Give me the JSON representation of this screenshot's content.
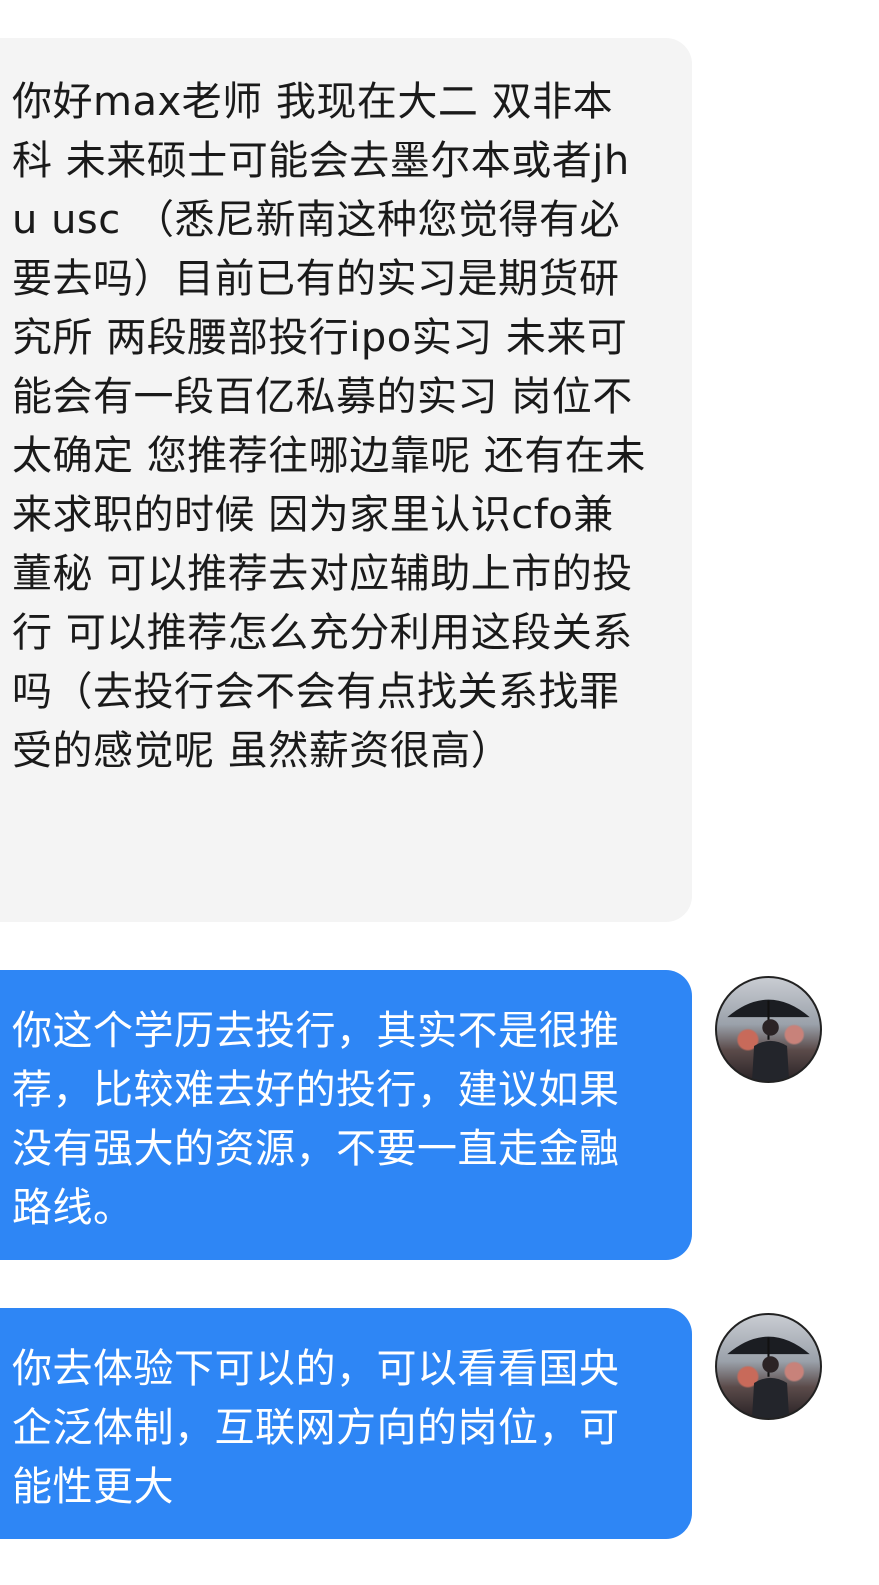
{
  "messages": [
    {
      "sender": "user",
      "text": "你好max老师 我现在大二 双非本科 未来硕士可能会去墨尔本或者jhu usc （悉尼新南这种您觉得有必要去吗）目前已有的实习是期货研究所 两段腰部投行ipo实习 未来可能会有一段百亿私募的实习 岗位不太确定 您推荐往哪边靠呢 还有在未来求职的时候 因为家里认识cfo兼董秘 可以推荐去对应辅助上市的投行 可以推荐怎么充分利用这段关系吗（去投行会不会有点找关系找罪受的感觉呢 虽然薪资很高）"
    },
    {
      "sender": "teacher",
      "text": "你这个学历去投行，其实不是很推荐，比较难去好的投行，建议如果没有强大的资源，不要一直走金融路线。"
    },
    {
      "sender": "teacher",
      "text": "你去体验下可以的，可以看看国央企泛体制，互联网方向的岗位，可能性更大"
    }
  ],
  "colors": {
    "incoming_bubble": "#f4f4f4",
    "outgoing_bubble": "#2e86f5",
    "outgoing_text": "#ffffff",
    "incoming_text": "#1a1a1a"
  },
  "icons": {
    "avatar": "man-with-umbrella-avatar"
  }
}
